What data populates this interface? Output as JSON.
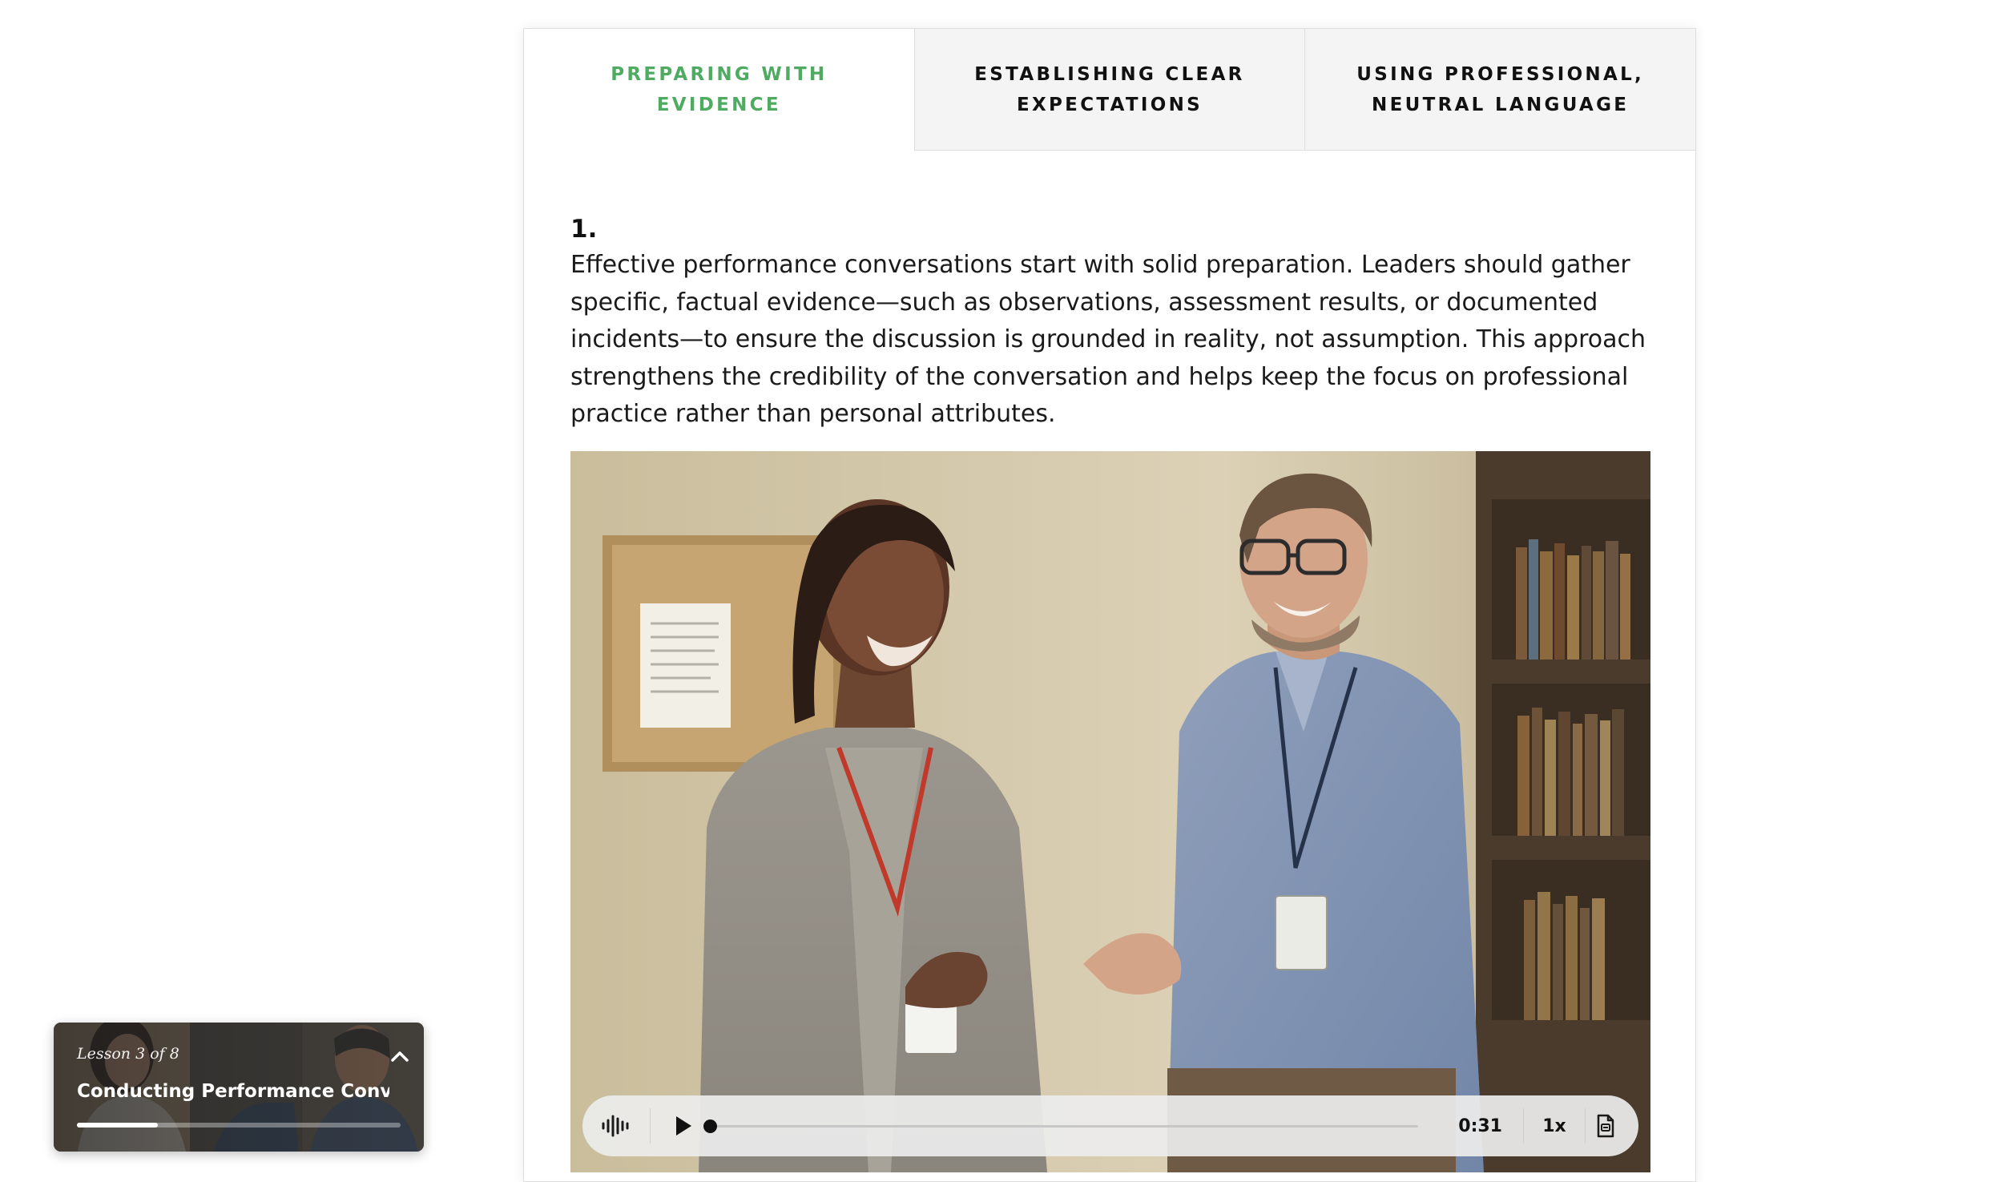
{
  "tabs": [
    {
      "label": "PREPARING WITH EVIDENCE",
      "active": true
    },
    {
      "label": "ESTABLISHING CLEAR EXPECTATIONS",
      "active": false
    },
    {
      "label": "USING PROFESSIONAL, NEUTRAL LANGUAGE",
      "active": false
    }
  ],
  "content": {
    "step_number": "1.",
    "paragraph": "Effective performance conversations start with solid preparation. Leaders should gather specific, factual evidence—such as observations, assessment results, or documented incidents—to ensure the discussion is grounded in reality, not assumption. This approach strengthens the credibility of the conversation and helps keep the focus on professional practice rather than personal attributes."
  },
  "player": {
    "waveform_icon": "waveform-icon",
    "play_icon": "play-icon",
    "progress_fraction": 0.0,
    "time": "0:31",
    "speed": "1x",
    "transcript_icon": "transcript-icon"
  },
  "lesson_widget": {
    "count": "Lesson 3 of 8",
    "title": "Conducting Performance Convers...",
    "progress_fraction": 0.25,
    "chevron_icon": "chevron-up-icon"
  },
  "colors": {
    "accent_green": "#4faa62",
    "tab_inactive_bg": "#f4f4f4",
    "text": "#111111"
  }
}
